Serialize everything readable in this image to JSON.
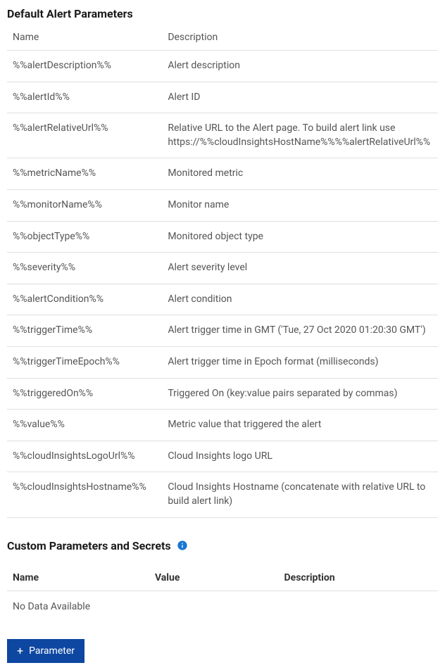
{
  "defaultSection": {
    "title": "Default Alert Parameters",
    "headers": {
      "name": "Name",
      "description": "Description"
    },
    "rows": [
      {
        "name": "%%alertDescription%%",
        "description": "Alert description"
      },
      {
        "name": "%%alertId%%",
        "description": "Alert ID"
      },
      {
        "name": "%%alertRelativeUrl%%",
        "description": "Relative URL to the Alert page. To build alert link use https://%%cloudInsightsHostName%%%%alertRelativeUrl%%"
      },
      {
        "name": "%%metricName%%",
        "description": "Monitored metric"
      },
      {
        "name": "%%monitorName%%",
        "description": "Monitor name"
      },
      {
        "name": "%%objectType%%",
        "description": "Monitored object type"
      },
      {
        "name": "%%severity%%",
        "description": "Alert severity level"
      },
      {
        "name": "%%alertCondition%%",
        "description": "Alert condition"
      },
      {
        "name": "%%triggerTime%%",
        "description": "Alert trigger time in GMT ('Tue, 27 Oct 2020 01:20:30 GMT')"
      },
      {
        "name": "%%triggerTimeEpoch%%",
        "description": "Alert trigger time in Epoch format (milliseconds)"
      },
      {
        "name": "%%triggeredOn%%",
        "description": "Triggered On (key:value pairs separated by commas)"
      },
      {
        "name": "%%value%%",
        "description": "Metric value that triggered the alert"
      },
      {
        "name": "%%cloudInsightsLogoUrl%%",
        "description": "Cloud Insights logo URL"
      },
      {
        "name": "%%cloudInsightsHostname%%",
        "description": "Cloud Insights Hostname (concatenate with relative URL to build alert link)"
      }
    ]
  },
  "customSection": {
    "title": "Custom Parameters and Secrets",
    "headers": {
      "name": "Name",
      "value": "Value",
      "description": "Description"
    },
    "emptyText": "No Data Available",
    "addButtonLabel": "Parameter"
  }
}
